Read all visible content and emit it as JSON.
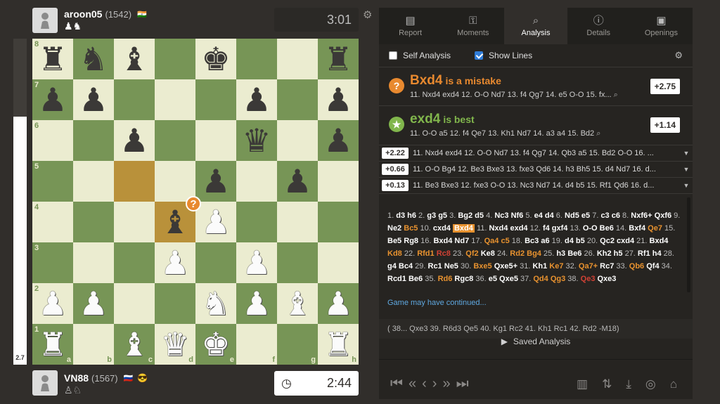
{
  "top_player": {
    "name": "aroon05",
    "rating": "(1542)",
    "flag": "🇮🇳",
    "clock": "3:01",
    "captured": "♟♞"
  },
  "bottom_player": {
    "name": "VN88",
    "rating": "(1567)",
    "flag": "🇷🇺",
    "badge": "😎",
    "clock": "2:44",
    "captured": "♙♘"
  },
  "eval": {
    "value": "2.7",
    "white_fraction": 0.76
  },
  "board": {
    "files": [
      "a",
      "b",
      "c",
      "d",
      "e",
      "f",
      "g",
      "h"
    ],
    "ranks": [
      "8",
      "7",
      "6",
      "5",
      "4",
      "3",
      "2",
      "1"
    ],
    "rows": [
      [
        "r",
        "n",
        "b",
        "",
        "k",
        "",
        "",
        "r"
      ],
      [
        "p",
        "p",
        "",
        "",
        "",
        "p",
        "",
        "p"
      ],
      [
        "",
        "",
        "p",
        "",
        "",
        "q",
        "",
        "p"
      ],
      [
        "",
        "",
        "",
        "",
        "p",
        "",
        "p",
        ""
      ],
      [
        "",
        "",
        "",
        "b",
        "P",
        "",
        "",
        ""
      ],
      [
        "",
        "",
        "",
        "P",
        "",
        "P",
        "",
        ""
      ],
      [
        "P",
        "P",
        "",
        "",
        "N",
        "P",
        "B",
        "P"
      ],
      [
        "R",
        "",
        "B",
        "Q",
        "K",
        "",
        "",
        "R"
      ]
    ],
    "highlight": [
      "c5",
      "d4"
    ],
    "mistake_square": "d4"
  },
  "tabs": [
    {
      "label": "Report",
      "icon": "report-icon",
      "glyph": "▤"
    },
    {
      "label": "Moments",
      "icon": "key-icon",
      "glyph": "⚿"
    },
    {
      "label": "Analysis",
      "icon": "magnifier-icon",
      "glyph": "⌕",
      "active": true
    },
    {
      "label": "Details",
      "icon": "info-icon",
      "glyph": "ⓘ"
    },
    {
      "label": "Openings",
      "icon": "book-icon",
      "glyph": "▣"
    }
  ],
  "options": {
    "self_analysis": "Self Analysis",
    "show_lines": "Show Lines"
  },
  "mistake": {
    "move": "Bxd4",
    "text": "is a mistake",
    "line": "11. Nxd4 exd4 12. O-O Nd7 13. f4 Qg7 14. e5 O-O 15. fx...",
    "score": "+2.75",
    "color": "#e8892f"
  },
  "best": {
    "move": "exd4",
    "text": "is best",
    "line": "11. O-O a5 12. f4 Qe7 13. Kh1 Nd7 14. a3 a4 15. Bd2",
    "score": "+1.14",
    "color": "#81b64c"
  },
  "engine_lines": [
    {
      "score": "+2.22",
      "line": "11. Nxd4 exd4 12. O-O Nd7 13. f4 Qg7 14. Qb3 a5 15. Bd2 O-O 16. ..."
    },
    {
      "score": "+0.66",
      "line": "11. O-O Bg4 12. Be3 Bxe3 13. fxe3 Qd6 14. h3 Bh5 15. d4 Nd7 16. d..."
    },
    {
      "score": "+0.13",
      "line": "11. Be3 Bxe3 12. fxe3 O-O 13. Nc3 Nd7 14. d4 b5 15. Rf1 Qd6 16. d..."
    }
  ],
  "game_continued": "Game may have continued...",
  "continuation": "( 38... Qxe3 39. R6d3 Qe5 40. Kg1 Rc2 41. Kh1 Rc1 42. Rd2 -M18)",
  "saved_analysis": "Saved Analysis"
}
